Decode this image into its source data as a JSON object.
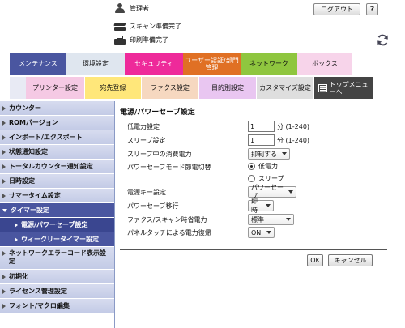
{
  "header": {
    "user_label": "管理者",
    "logout_label": "ログアウト",
    "help_label": "?",
    "scan_status": "スキャン準備完了",
    "print_status": "印刷準備完了"
  },
  "main_tabs": [
    {
      "label": "メンテナンス",
      "color": "#4a56a0",
      "text_color": "#ffffff"
    },
    {
      "label": "環境設定",
      "color": "#dfe6ef",
      "text_color": "#111111"
    },
    {
      "label": "セキュリティ",
      "color": "#ee2a9a",
      "text_color": "#ffffff"
    },
    {
      "label": "ユーザー認証/部門管理",
      "color": "#e07024",
      "text_color": "#ffffff"
    },
    {
      "label": "ネットワーク",
      "color": "#8fc63f",
      "text_color": "#111111"
    },
    {
      "label": "ボックス",
      "color": "#f7d4ea",
      "text_color": "#111111"
    }
  ],
  "sub_tabs": [
    {
      "label": "プリンター設定",
      "color": "#f5c9e4"
    },
    {
      "label": "宛先登録",
      "color": "#ffe77a"
    },
    {
      "label": "ファクス設定",
      "color": "#f6d8c0"
    },
    {
      "label": "目的別設定",
      "color": "#e9c6f1"
    },
    {
      "label": "カスタマイズ設定",
      "color": "#dedede"
    }
  ],
  "top_menu": {
    "label": "トップメニューへ"
  },
  "sidebar": {
    "items": [
      {
        "label": "カウンター"
      },
      {
        "label": "ROMバージョン"
      },
      {
        "label": "インポート/エクスポート"
      },
      {
        "label": "状態通知設定"
      },
      {
        "label": "トータルカウンター通知設定"
      },
      {
        "label": "日時設定"
      },
      {
        "label": "サマータイム設定"
      },
      {
        "label": "タイマー設定"
      }
    ],
    "sub_items": [
      {
        "label": "電源/パワーセーブ設定"
      },
      {
        "label": "ウィークリータイマー設定"
      }
    ],
    "items_after": [
      {
        "label": "ネットワークエラーコード表示設定"
      },
      {
        "label": "初期化"
      },
      {
        "label": "ライセンス管理設定"
      },
      {
        "label": "フォント/マクロ編集"
      }
    ]
  },
  "content": {
    "title": "電源/パワーセーブ設定",
    "fields": {
      "low_power": {
        "label": "低電力設定",
        "value": "1",
        "range": "分 (1-240)"
      },
      "sleep": {
        "label": "スリープ設定",
        "value": "1",
        "range": "分 (1-240)"
      },
      "sleep_consumption": {
        "label": "スリープ中の消費電力",
        "value": "抑制する"
      },
      "power_save_mode": {
        "label": "パワーセーブモード節電切替",
        "option_low": "低電力",
        "option_sleep": "スリープ",
        "selected": "低電力"
      },
      "power_key": {
        "label": "電源キー設定",
        "value": "パワーセーブ"
      },
      "power_save_transition": {
        "label": "パワーセーブ移行",
        "value": "即時"
      },
      "fax_scan_power": {
        "label": "ファクス/スキャン時省電力",
        "value": "標準"
      },
      "panel_touch": {
        "label": "パネルタッチによる電力復帰",
        "value": "ON"
      }
    },
    "ok_label": "OK",
    "cancel_label": "キャンセル"
  }
}
